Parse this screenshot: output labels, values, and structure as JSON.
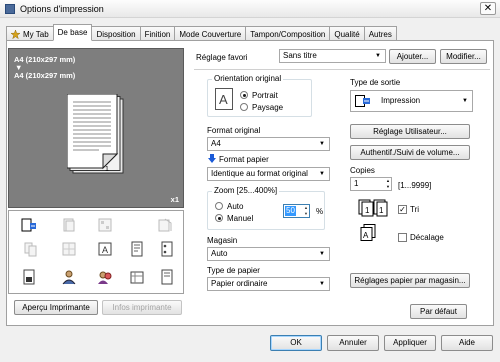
{
  "window": {
    "title": "Options d'impression",
    "close_glyph": "✕"
  },
  "tabs": [
    {
      "label": "My Tab",
      "icon": "star-icon"
    },
    {
      "label": "De base",
      "active": true
    },
    {
      "label": "Disposition"
    },
    {
      "label": "Finition"
    },
    {
      "label": "Mode Couverture"
    },
    {
      "label": "Tampon/Composition"
    },
    {
      "label": "Qualité"
    },
    {
      "label": "Autres"
    }
  ],
  "preview": {
    "line1": "A4 (210x297 mm)",
    "arrow": "▼",
    "line2": "A4 (210x297 mm)",
    "page_number": "1",
    "copies_badge": "x1"
  },
  "left_buttons": {
    "preview": "Aperçu Imprimante",
    "info": "Infos imprimante"
  },
  "favorite": {
    "label": "Réglage favori",
    "value": "Sans titre",
    "add": "Ajouter...",
    "modify": "Modifier..."
  },
  "orientation": {
    "label": "Orientation original",
    "portrait": "Portrait",
    "landscape": "Paysage",
    "selected": "Portrait"
  },
  "original_format": {
    "label": "Format original",
    "value": "A4"
  },
  "paper_format": {
    "label": "Format papier",
    "value": "Identique au format original"
  },
  "zoom": {
    "label": "Zoom [25...400%]",
    "auto": "Auto",
    "manual": "Manuel",
    "selected": "Manuel",
    "value": "50",
    "unit": "%"
  },
  "magasin": {
    "label": "Magasin",
    "value": "Auto"
  },
  "paper_type": {
    "label": "Type de papier",
    "value": "Papier ordinaire"
  },
  "output": {
    "label": "Type de sortie",
    "value": "Impression"
  },
  "user_settings_button": "Réglage Utilisateur...",
  "auth_button": "Authentif./Suivi de volume...",
  "copies": {
    "label": "Copies",
    "value": "1",
    "range": "[1...9999]"
  },
  "collate": {
    "label": "Tri",
    "checked": true
  },
  "offset": {
    "label": "Décalage",
    "checked": false
  },
  "tray_settings_button": "Réglages papier par magasin...",
  "default_button": "Par défaut",
  "footer": {
    "ok": "OK",
    "cancel": "Annuler",
    "apply": "Appliquer",
    "help": "Aide"
  },
  "colors": {
    "selected_blue": "#0a5ad2",
    "preview_gray": "#7e7e7e"
  }
}
